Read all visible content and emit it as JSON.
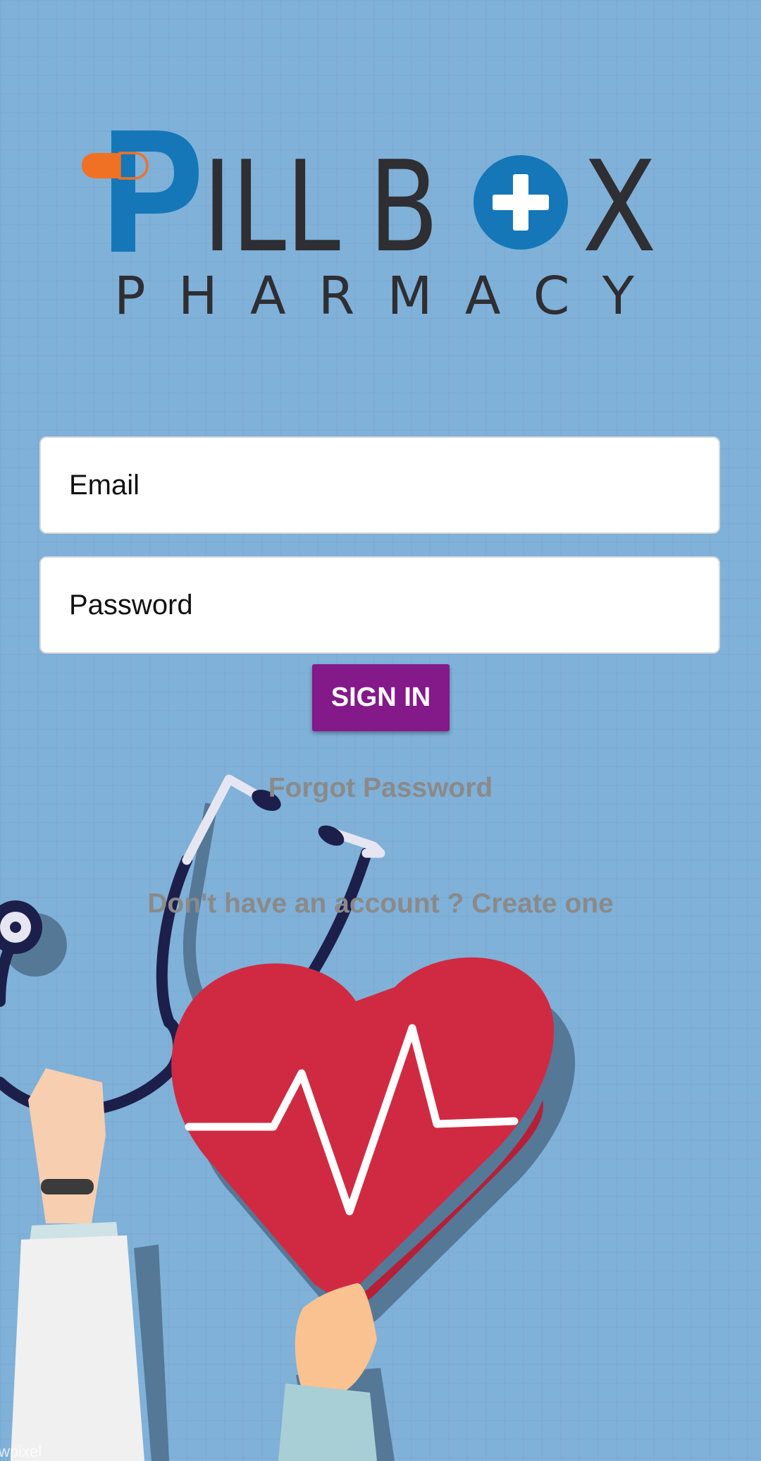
{
  "logo": {
    "brand_word_1": "ILL",
    "brand_letter_b": "B",
    "brand_letter_x": "X",
    "tagline": "P H A R M A C Y"
  },
  "login": {
    "email_placeholder": "Email",
    "password_placeholder": "Password",
    "signin_label": "SIGN IN",
    "forgot_label": "Forgot Password",
    "create_label": "Don't have an account ? Create one"
  },
  "watermark": "wpixel",
  "colors": {
    "background": "#80b1d8",
    "brand_blue": "#1577b8",
    "pill_orange": "#f07124",
    "button_purple": "#84198a",
    "heart_red": "#d02a43",
    "link_gray": "#8a8a8a"
  }
}
